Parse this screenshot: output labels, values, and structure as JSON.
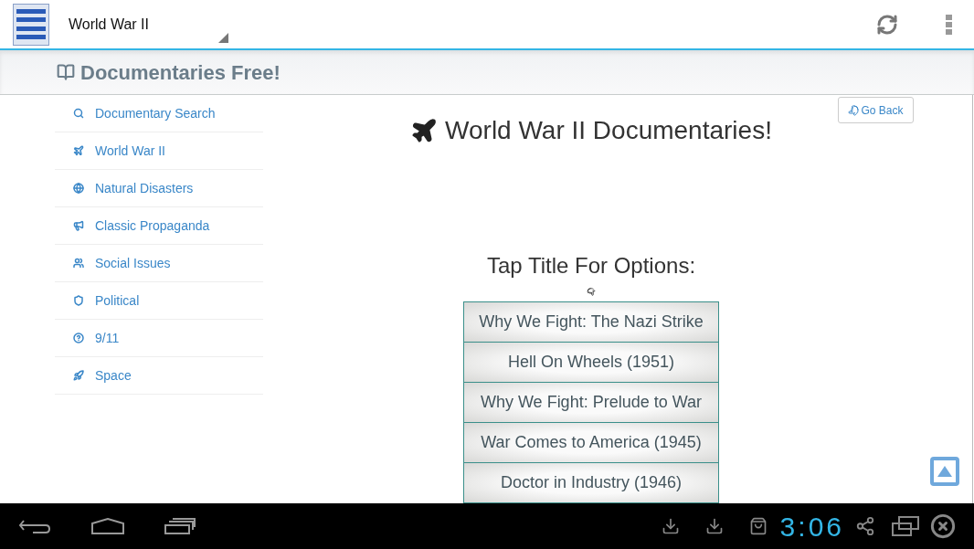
{
  "action_bar": {
    "title": "World War II"
  },
  "header": {
    "title": "Documentaries Free!"
  },
  "sidebar": {
    "items": [
      {
        "label": "Documentary Search"
      },
      {
        "label": "World War II"
      },
      {
        "label": "Natural Disasters"
      },
      {
        "label": "Classic Propaganda"
      },
      {
        "label": "Social Issues"
      },
      {
        "label": "Political"
      },
      {
        "label": "9/11"
      },
      {
        "label": "Space"
      }
    ]
  },
  "main": {
    "go_back": "Go Back",
    "title": "World War II Documentaries!",
    "prompt": "Tap Title For Options:",
    "titles": [
      "Why We Fight: The Nazi Strike",
      "Hell On Wheels (1951)",
      "Why We Fight: Prelude to War",
      "War Comes to America (1945)",
      "Doctor in Industry (1946)"
    ]
  },
  "system_bar": {
    "time": "3:06"
  }
}
